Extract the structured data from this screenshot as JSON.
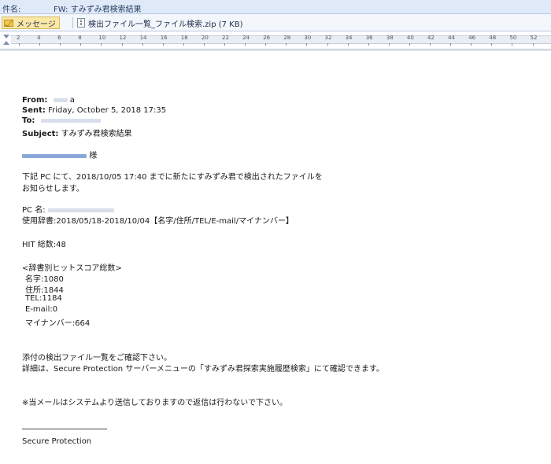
{
  "subject_bar": {
    "label": "件名:",
    "value": "FW: すみずみ君検索結果"
  },
  "tabs": {
    "message_label": "メッセージ",
    "attachment_label": "検出ファイル一覧_ファイル検索.zip (7 KB)"
  },
  "ruler": {
    "ticks": [
      "2",
      "4",
      "6",
      "8",
      "10",
      "12",
      "14",
      "16",
      "18",
      "20",
      "22",
      "24",
      "26",
      "28",
      "30",
      "32",
      "34",
      "36",
      "38",
      "40",
      "42",
      "44",
      "46",
      "48",
      "50",
      "52"
    ]
  },
  "email": {
    "from_key": "From:",
    "from_val": "a",
    "sent_key": "Sent:",
    "sent_val": "Friday, October 5, 2018 17:35",
    "to_key": "To:",
    "to_val": "",
    "subject_key": "Subject:",
    "subject_val": "すみずみ君検索結果",
    "recipient_suffix": "様",
    "line1": "下記 PC にて、2018/10/05 17:40 までに新たにすみずみ君で検出されたファイルを",
    "line2": "お知らせします。",
    "pc_label": "PC 名:",
    "dict_line": "使用辞書:2018/05/18-2018/10/04【名字/住所/TEL/E-mail/マイナンバー】",
    "hit_total": "HIT 総数:48",
    "score_header": "<辞書別ヒットスコア総数>",
    "score_name": "名字:1080",
    "score_address": "住所:1844",
    "score_tel": "TEL:1184",
    "score_email": "E-mail:0",
    "score_mynumber": "マイナンバー:664",
    "confirm_line": "添付の検出ファイル一覧をご確認下さい。",
    "detail_line": "詳細は、Secure Protection サーバーメニューの「すみずみ君探索実施履歴検索」にて確認できます。",
    "notice_line": "※当メールはシステムより送信しておりますので返信は行わないで下さい。",
    "signature": "Secure Protection"
  }
}
